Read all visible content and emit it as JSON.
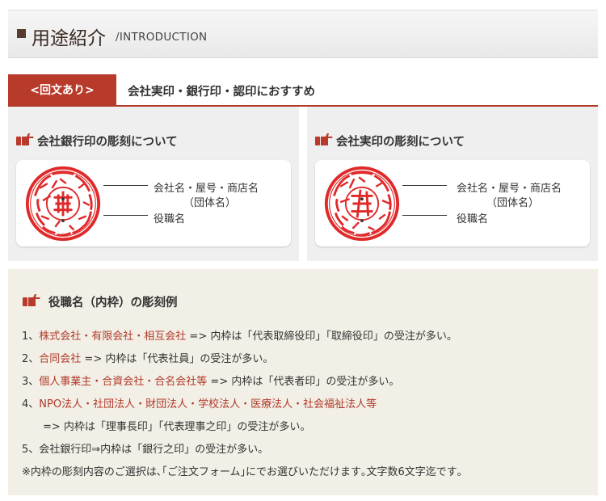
{
  "header": {
    "title": "用途紹介",
    "subtitle": "/INTRODUCTION"
  },
  "tab": {
    "badge": "<回文あり>",
    "text": "会社実印・銀行印・認印におすすめ"
  },
  "panels": [
    {
      "title": "会社銀行印の彫刻について",
      "labels": {
        "outer_line1": "会社名・屋号・商店名",
        "outer_line2": "（団体名）",
        "inner": "役職名"
      }
    },
    {
      "title": "会社実印の彫刻について",
      "labels": {
        "outer_line1": "会社名・屋号・商店名",
        "outer_line2": "（団体名）",
        "inner": "役職名"
      }
    }
  ],
  "examples": {
    "title": "役職名（内枠）の彫刻例",
    "items": [
      {
        "num": "1、",
        "name": "株式会社・有限会社・相互会社",
        "text": " => 内枠は「代表取締役印」「取締役印」の受注が多い。"
      },
      {
        "num": "2、",
        "name": "合同会社",
        "text": " => 内枠は「代表社員」の受注が多い。"
      },
      {
        "num": "3、",
        "name": "個人事業主・合資会社・合名会社等",
        "text": " => 内枠は「代表者印」の受注が多い。"
      },
      {
        "num": "4、",
        "name": "NPO法人・社団法人・財団法人・学校法人・医療法人・社会福祉法人等",
        "text": ""
      }
    ],
    "item4_cont": "=> 内枠は「理事長印」「代表理事之印」の受注が多い。",
    "item5": "5、会社銀行印⇒内枠は「銀行之印」の受注が多い。",
    "note": "※内枠の彫刻内容のご選択は､｢ご注文フォーム｣にでお選びいただけます｡文字数6文字迄です｡"
  },
  "colors": {
    "accent": "#b83a2b",
    "seal": "#e02a2a"
  }
}
